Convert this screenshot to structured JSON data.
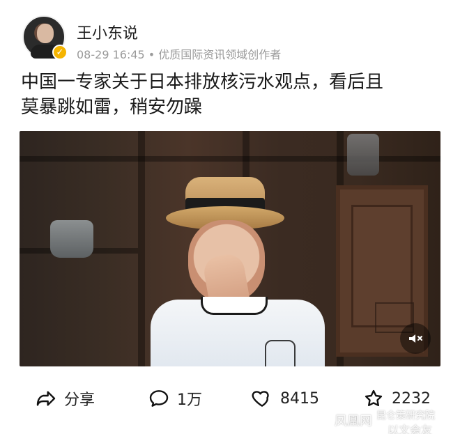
{
  "post": {
    "author": {
      "name": "王小东说",
      "meta": "08-29 16:45 • 优质国际资讯领域创作者"
    },
    "title_lines": [
      "中国一专家关于日本排放核污水观点，看后且",
      "莫暴跳如雷，稍安勿躁"
    ],
    "video": {
      "muted": true
    },
    "actions": [
      {
        "key": "share",
        "label": "分享",
        "icon": "share-icon"
      },
      {
        "key": "comment",
        "label": "1万",
        "icon": "comment-icon"
      },
      {
        "key": "like",
        "label": "8415",
        "icon": "heart-icon"
      },
      {
        "key": "star",
        "label": "2232",
        "icon": "star-icon"
      }
    ]
  },
  "watermark": {
    "brand": "凤凰网",
    "source": "昆仑策研究院",
    "sub": "以文会友"
  },
  "colors": {
    "meta_text": "#9a9a9a",
    "verified_badge": "#f5b400"
  }
}
